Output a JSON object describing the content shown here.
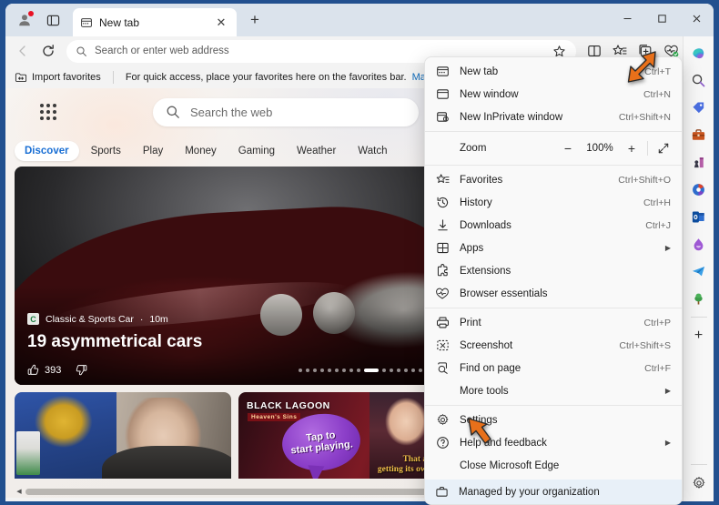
{
  "window": {
    "controls": {
      "minimize": "–",
      "maximize": "□",
      "close": "✕"
    }
  },
  "tabstrip": {
    "profile_icon": "profile-icon",
    "tab_search_icon": "tab-search-icon",
    "tabs": [
      {
        "title": "New tab",
        "icon": "new-tab-page-icon",
        "close": "✕"
      }
    ],
    "new_tab_button": "+"
  },
  "toolbar": {
    "back_icon": "back-arrow-icon",
    "refresh_icon": "refresh-icon",
    "address": {
      "placeholder": "Search or enter web address",
      "value": "",
      "search_icon": "search-icon"
    },
    "buttons": [
      {
        "name": "add-favorite",
        "icon": "star-outline-icon"
      },
      {
        "name": "split-screen",
        "icon": "split-screen-icon"
      },
      {
        "name": "favorites",
        "icon": "favorites-star-list-icon"
      },
      {
        "name": "collections",
        "icon": "collections-icon"
      },
      {
        "name": "browser-essentials",
        "icon": "browser-essentials-heart-icon"
      },
      {
        "name": "settings-and-more",
        "icon": "ellipsis-icon"
      }
    ]
  },
  "favorites_bar": {
    "import_label": "Import favorites",
    "import_icon": "import-favorites-icon",
    "hint_text": "For quick access, place your favorites here on the favorites bar.",
    "manage_link": "Manage favorites"
  },
  "newtab": {
    "apps_icon": "app-launcher-icon",
    "search": {
      "placeholder": "Search the web",
      "icon": "search-icon"
    },
    "nav": [
      {
        "label": "Discover",
        "active": true
      },
      {
        "label": "Sports",
        "active": false
      },
      {
        "label": "Play",
        "active": false
      },
      {
        "label": "Money",
        "active": false
      },
      {
        "label": "Gaming",
        "active": false
      },
      {
        "label": "Weather",
        "active": false
      },
      {
        "label": "Watch",
        "active": false
      }
    ],
    "nav_more": "⋯",
    "hero": {
      "source": "Classic & Sports Car",
      "source_initials": "C",
      "time": "10m",
      "separator": "·",
      "title": "19 asymmetrical cars",
      "like_icon": "thumbs-up-icon",
      "likes": "393",
      "dislike_icon": "thumbs-down-icon",
      "dots_total": 16,
      "dots_active_index": 9
    },
    "cards": [
      {
        "name": "news-photo-card",
        "caption": ""
      },
      {
        "name": "black-lagoon-ad-card",
        "logo": "BLACK LAGOON",
        "sublogo": "Heaven's Sins",
        "bubble_line1": "Tap to",
        "bubble_line2": "start playing.",
        "cta_line1": "That anime is",
        "cta_line2": "getting its own game"
      }
    ],
    "scroll_left_arrow": "◀"
  },
  "sidebar": {
    "items": [
      {
        "name": "copilot",
        "icon": "copilot-icon"
      },
      {
        "name": "search",
        "icon": "search-icon"
      },
      {
        "name": "shopping",
        "icon": "shopping-tag-icon"
      },
      {
        "name": "tools",
        "icon": "briefcase-icon"
      },
      {
        "name": "games",
        "icon": "games-icon"
      },
      {
        "name": "microsoft-365",
        "icon": "microsoft-365-icon"
      },
      {
        "name": "outlook",
        "icon": "outlook-icon"
      },
      {
        "name": "drop",
        "icon": "drop-icon"
      },
      {
        "name": "telegram",
        "icon": "paper-plane-icon"
      },
      {
        "name": "tree",
        "icon": "tree-icon"
      }
    ],
    "add_button": "+",
    "settings_icon": "gear-icon"
  },
  "menu": {
    "groups": [
      {
        "items": [
          {
            "label": "New tab",
            "accel": "Ctrl+T",
            "icon": "new-tab-icon",
            "submenu": false
          },
          {
            "label": "New window",
            "accel": "Ctrl+N",
            "icon": "new-window-icon",
            "submenu": false
          },
          {
            "label": "New InPrivate window",
            "accel": "Ctrl+Shift+N",
            "icon": "inprivate-icon",
            "submenu": false
          }
        ]
      },
      {
        "zoom": {
          "label": "Zoom",
          "minus": "−",
          "value": "100%",
          "plus": "+",
          "fullscreen_icon": "fullscreen-icon"
        }
      },
      {
        "items": [
          {
            "label": "Favorites",
            "accel": "Ctrl+Shift+O",
            "icon": "favorites-icon",
            "submenu": false
          },
          {
            "label": "History",
            "accel": "Ctrl+H",
            "icon": "history-icon",
            "submenu": false
          },
          {
            "label": "Downloads",
            "accel": "Ctrl+J",
            "icon": "downloads-icon",
            "submenu": false
          },
          {
            "label": "Apps",
            "accel": "",
            "icon": "apps-icon",
            "submenu": true
          },
          {
            "label": "Extensions",
            "accel": "",
            "icon": "extensions-icon",
            "submenu": false
          },
          {
            "label": "Browser essentials",
            "accel": "",
            "icon": "browser-essentials-icon",
            "submenu": false
          }
        ]
      },
      {
        "items": [
          {
            "label": "Print",
            "accel": "Ctrl+P",
            "icon": "print-icon",
            "submenu": false
          },
          {
            "label": "Screenshot",
            "accel": "Ctrl+Shift+S",
            "icon": "screenshot-icon",
            "submenu": false
          },
          {
            "label": "Find on page",
            "accel": "Ctrl+F",
            "icon": "find-icon",
            "submenu": false
          },
          {
            "label": "More tools",
            "accel": "",
            "icon": "",
            "submenu": true
          }
        ]
      },
      {
        "items": [
          {
            "label": "Settings",
            "accel": "",
            "icon": "gear-icon",
            "submenu": false
          },
          {
            "label": "Help and feedback",
            "accel": "",
            "icon": "help-icon",
            "submenu": true
          },
          {
            "label": "Close Microsoft Edge",
            "accel": "",
            "icon": "",
            "submenu": false
          }
        ]
      }
    ],
    "footer": {
      "label": "Managed by your organization",
      "icon": "briefcase-icon"
    }
  },
  "cursors": [
    {
      "name": "cursor-pointing-to-settings-and-more-button"
    },
    {
      "name": "cursor-pointing-to-settings-menu-item"
    }
  ],
  "colors": {
    "accent": "#0f6cbd",
    "window_chrome": "#dbe3ec",
    "toolbar": "#f3f3f3",
    "menu_bg": "#f9f9f9",
    "menu_footer_bg": "#e8f0f8",
    "cursor_orange": "#e8701a",
    "desktop": "#22508f"
  }
}
